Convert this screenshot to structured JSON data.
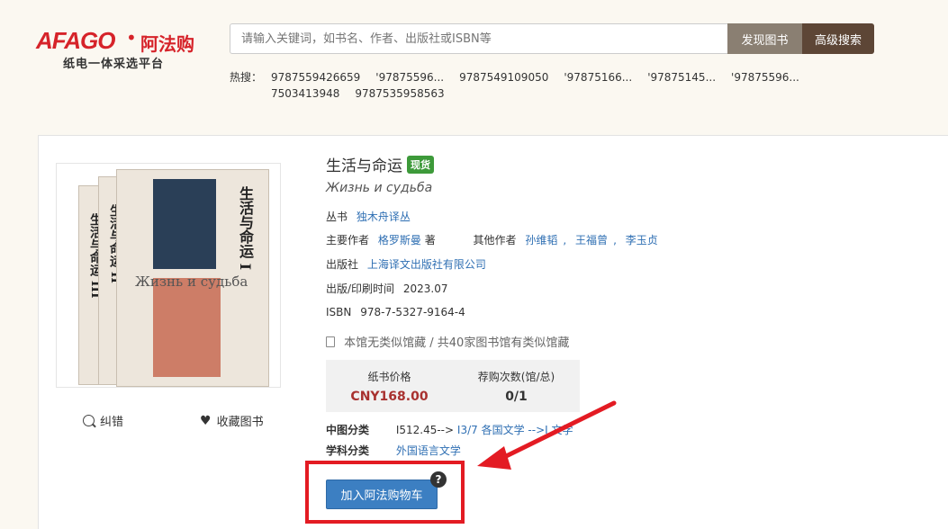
{
  "header": {
    "logo_mark": "AFAGO",
    "logo_cn": "阿法购",
    "logo_sub": "纸电一体采选平台",
    "search_placeholder": "请输入关键词，如书名、作者、出版社或ISBN等",
    "find_label": "发现图书",
    "adv_label": "高级搜索",
    "hot_label": "热搜：",
    "hot_items": [
      "9787559426659",
      "'97875596...",
      "9787549109050",
      "'97875166...",
      "'97875145...",
      "'97875596...",
      "7503413948",
      "9787535958563"
    ]
  },
  "book": {
    "title": "生活与命运",
    "badge": "现货",
    "subtitle": "Жизнь и судьба",
    "series_label": "丛书",
    "series": "独木舟译丛",
    "author_label": "主要作者",
    "author": "格罗斯曼",
    "author_role": "著",
    "other_label": "其他作者",
    "others": [
      "孙维韬",
      "王福曾",
      "李玉贞"
    ],
    "publisher_label": "出版社",
    "publisher": "上海译文出版社有限公司",
    "date_label": "出版/印刷时间",
    "date": "2023.07",
    "isbn_label": "ISBN",
    "isbn": "978-7-5327-9164-4",
    "holdings": "本馆无类似馆藏 / 共40家图书馆有类似馆藏",
    "cover_title": "生活与命运",
    "cover_vol": "I",
    "cover_ru": "Жизнь и судьба",
    "spine1": "生活与命运 III",
    "spine2": "生活与命运 II"
  },
  "stats": {
    "price_label": "纸书价格",
    "price": "CNY168.00",
    "count_label": "荐购次数(馆/总)",
    "count": "0/1"
  },
  "classification": {
    "clc_label": "中图分类",
    "clc_code": "I512.45-->",
    "clc_link": "I3/7 各国文学",
    "clc_tail": "-->I 文学",
    "subject_label": "学科分类",
    "subject": "外国语言文学"
  },
  "actions": {
    "correct": "纠错",
    "favorite": "收藏图书",
    "add_to_cart": "加入阿法购物车",
    "help": "?"
  },
  "colors": {
    "accent_red": "#e31b23",
    "link_blue": "#2f6fb3",
    "cart_blue": "#3c7fc2",
    "badge_green": "#3d9a3a"
  }
}
